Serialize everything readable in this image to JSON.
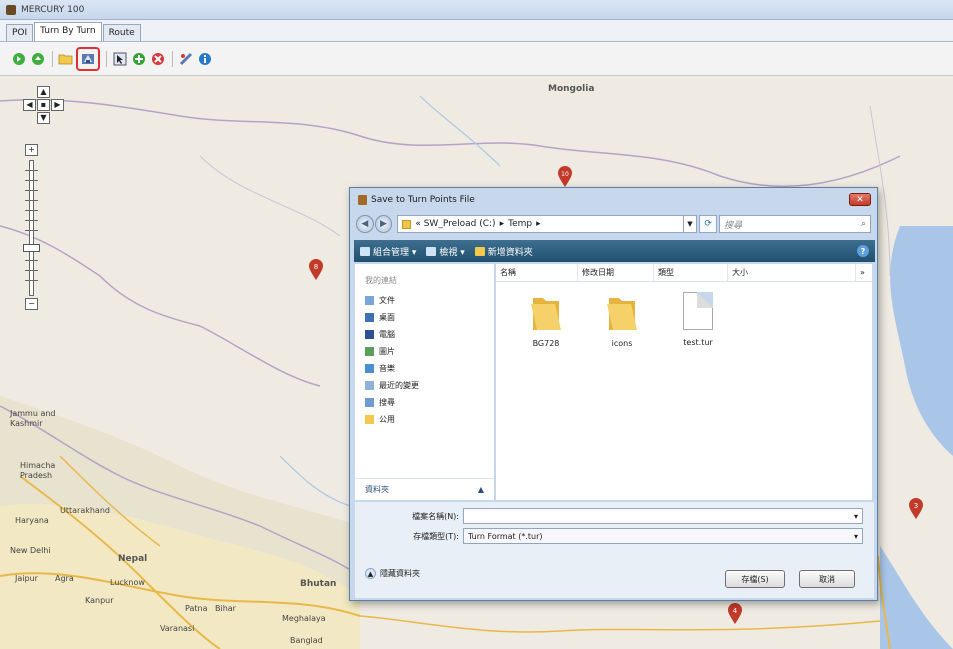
{
  "window": {
    "title": "MERCURY 100"
  },
  "tabs": [
    {
      "label": "POI"
    },
    {
      "label": "Turn By Turn"
    },
    {
      "label": "Route"
    }
  ],
  "toolbar": {
    "buttons": [
      "forward-icon",
      "refresh-icon",
      "open-folder-icon",
      "save-icon",
      "select-icon",
      "add-icon",
      "delete-icon",
      "route-icon",
      "info-icon"
    ],
    "highlight_color": "#e03030"
  },
  "map": {
    "labels": {
      "mongolia": "Mongolia",
      "jammu": "Jammu and",
      "kashmir": "Kashmir",
      "himachal": "Himacha",
      "pradesh": "Pradesh",
      "uttarakhand": "Uttarakhand",
      "haryana": "Haryana",
      "new_delhi": "New Delhi",
      "jaipur": "Jaipur",
      "agra": "Agra",
      "nepal": "Nepal",
      "kanpur": "Kanpur",
      "lucknow": "Lucknow",
      "patna": "Patna",
      "bihar": "Bihar",
      "varanasi": "Varanasi",
      "bhutan": "Bhutan",
      "meghalaya": "Meghalaya",
      "bangladesh": "Banglad"
    },
    "pins": [
      {
        "label": "8"
      },
      {
        "label": "10"
      },
      {
        "label": "3"
      },
      {
        "label": "4"
      }
    ],
    "zoom_level": 0.56
  },
  "dialog": {
    "title": "Save to Turn Points File",
    "address": {
      "path": [
        "« SW_Preload (C:)",
        "Temp"
      ]
    },
    "search_placeholder": "搜尋",
    "commands": {
      "organize": "組合管理 ▾",
      "views": "檢視 ▾",
      "new_folder": "新增資料夾"
    },
    "nav_pane": {
      "header": "我的連結",
      "items": [
        "文件",
        "桌面",
        "電腦",
        "圖片",
        "音樂",
        "最近的變更",
        "搜尋",
        "公用"
      ],
      "folders_label": "資料夾"
    },
    "columns": [
      "名稱",
      "修改日期",
      "類型",
      "大小"
    ],
    "files": [
      {
        "name": "BG728",
        "type": "folder"
      },
      {
        "name": "icons",
        "type": "folder"
      },
      {
        "name": "test.tur",
        "type": "file"
      }
    ],
    "filename_label": "檔案名稱(N):",
    "filename_value": "",
    "savetype_label": "存檔類型(T):",
    "savetype_value": "Turn Format (*.tur)",
    "hide_folders": "隱藏資料夾",
    "save_button": "存檔(S)",
    "cancel_button": "取消"
  }
}
